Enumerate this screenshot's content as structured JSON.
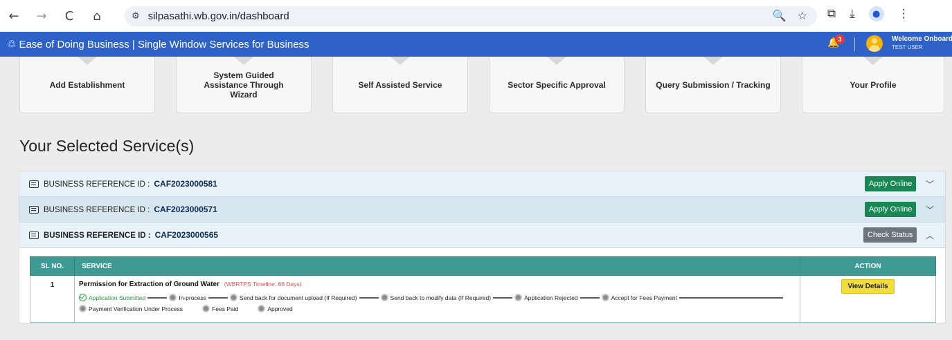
{
  "browser": {
    "url": "silpasathi.wb.gov.in/dashboard",
    "back_icon": "←",
    "forward_icon": "→",
    "reload_icon": "C",
    "home_icon": "⌂",
    "site_icon": "⚙",
    "zoom_icon": "🔍",
    "star_icon": "☆",
    "extensions_icon": "⧉",
    "download_icon": "⤓",
    "menu_icon": "⋮"
  },
  "header": {
    "logo": "♲",
    "title": "Ease of Doing Business | Single Window Services for Business",
    "notification_count": "3",
    "welcome": "Welcome Onboard",
    "user_name": "TEST USER",
    "brand_color": "#2e62c9"
  },
  "cards": [
    {
      "label": "Add Establishment"
    },
    {
      "label": "System Guided Assistance Through Wizard"
    },
    {
      "label": "Self Assisted Service"
    },
    {
      "label": "Sector Specific Approval"
    },
    {
      "label": "Query Submission / Tracking"
    },
    {
      "label": "Your Profile"
    }
  ],
  "section_title": "Your Selected Service(s)",
  "accordion": [
    {
      "label": "BUSINESS REFERENCE ID :",
      "ref_id": "CAF2023000581",
      "button": "Apply Online",
      "chevron": "﹀"
    },
    {
      "label": "BUSINESS REFERENCE ID :",
      "ref_id": "CAF2023000571",
      "button": "Apply Online",
      "chevron": "﹀"
    },
    {
      "label": "BUSINESS REFERENCE ID :",
      "ref_id": "CAF2023000565",
      "button": "Check Status",
      "chevron": "︿"
    }
  ],
  "table": {
    "headers": {
      "sl": "SL NO.",
      "service": "SERVICE",
      "action": "ACTION"
    },
    "rows": [
      {
        "sl": "1",
        "service": "Permission for Extraction of Ground Water",
        "timeline": "(WBRTPS Timeline: 66 Days)",
        "action": "View Details",
        "steps": [
          "Application Submitted",
          "In-process",
          "Send back for document upload (If Required)",
          "Send back to modify data (If Required)",
          "Application Rejected",
          "Accept for Fees Payment",
          "Payment Verification Under Process",
          "Fees Paid",
          "Approved"
        ]
      }
    ]
  },
  "colors": {
    "apply": "#198754",
    "check": "#6c757d",
    "table_header": "#3f9a93",
    "view": "#f3dd3b"
  }
}
